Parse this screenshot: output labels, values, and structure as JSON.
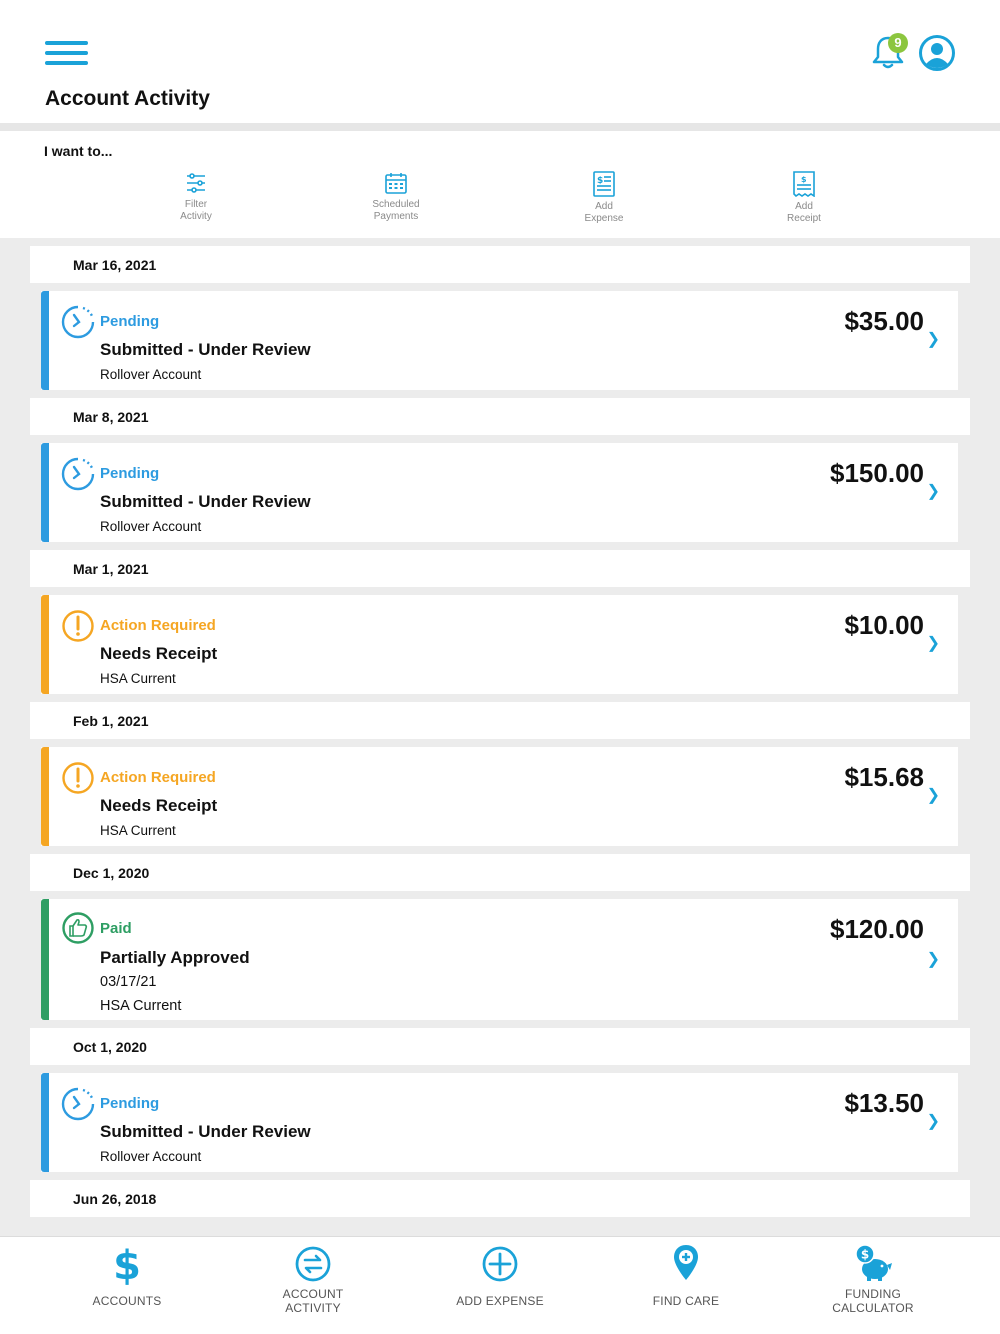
{
  "header": {
    "title": "Account Activity",
    "notification_count": "9"
  },
  "iwant": {
    "label": "I want to...",
    "actions": [
      {
        "line1": "Filter",
        "line2": "Activity"
      },
      {
        "line1": "Scheduled",
        "line2": "Payments"
      },
      {
        "line1": "Add",
        "line2": "Expense"
      },
      {
        "line1": "Add",
        "line2": "Receipt"
      }
    ]
  },
  "colors": {
    "accent": "#1aa2d8",
    "pending": "#2d9be0",
    "action_required": "#f5a623",
    "paid": "#2e9e63"
  },
  "activity": [
    {
      "date": "Mar 16, 2021",
      "status": "Pending",
      "title": "Submitted - Under Review",
      "sub1": "Rollover Account",
      "amount": "$35.00"
    },
    {
      "date": "Mar 8, 2021",
      "status": "Pending",
      "title": "Submitted - Under Review",
      "sub1": "Rollover Account",
      "amount": "$150.00"
    },
    {
      "date": "Mar 1, 2021",
      "status": "Action Required",
      "title": "Needs Receipt",
      "sub1": "HSA Current",
      "amount": "$10.00"
    },
    {
      "date": "Feb 1, 2021",
      "status": "Action Required",
      "title": "Needs Receipt",
      "sub1": "HSA Current",
      "amount": "$15.68"
    },
    {
      "date": "Dec 1, 2020",
      "status": "Paid",
      "title": "Partially Approved",
      "sub1": "03/17/21",
      "sub2": "HSA Current",
      "amount": "$120.00"
    },
    {
      "date": "Oct 1, 2020",
      "status": "Pending",
      "title": "Submitted - Under Review",
      "sub1": "Rollover Account",
      "amount": "$13.50"
    },
    {
      "date": "Jun 26, 2018"
    }
  ],
  "bottom_nav": [
    {
      "line1": "ACCOUNTS",
      "line2": ""
    },
    {
      "line1": "ACCOUNT",
      "line2": "ACTIVITY"
    },
    {
      "line1": "ADD EXPENSE",
      "line2": ""
    },
    {
      "line1": "FIND CARE",
      "line2": ""
    },
    {
      "line1": "FUNDING",
      "line2": "CALCULATOR"
    }
  ]
}
